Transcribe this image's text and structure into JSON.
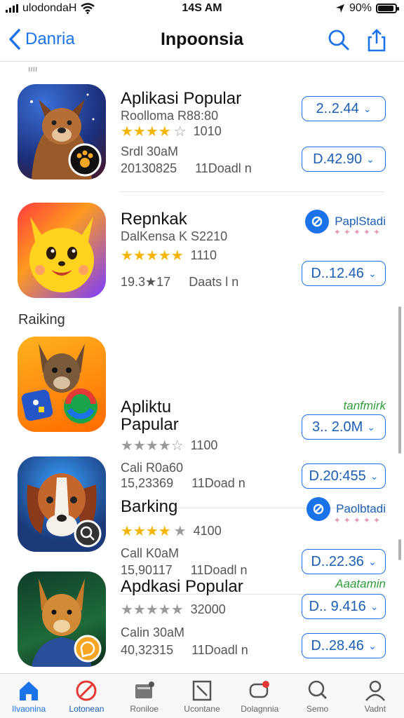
{
  "status_bar": {
    "carrier": "ulodondaH",
    "time": "14S AM",
    "battery": "90%"
  },
  "nav": {
    "back_label": "Danria",
    "title": "Inpoonsia",
    "search_icon": "search-icon",
    "share_icon": "share-icon"
  },
  "section_label": "Raiking",
  "items": [
    {
      "name": "Aplikasi Popular",
      "subtitle": "Roolloma R88:80",
      "rating": 4.5,
      "rating_count": "1010",
      "meta1": "Srdl 30aM",
      "meta2": "20130825",
      "meta3": "11Doadl n",
      "price1": "2..2.44",
      "price2": "D.42.90"
    },
    {
      "name": "Repnkak",
      "subtitle": "DalKensa K S2210",
      "rating": 5,
      "rating_count": "1110",
      "meta1": "19.3★17",
      "meta2": "Daats l n",
      "badge": "PaplStadi",
      "price1": "D..12.46"
    },
    {
      "name_line1": "Apliktu",
      "name_line2": "Papular",
      "green_label": "tanfmirk",
      "rating": 4.5,
      "rating_count": "1100",
      "meta1": "Cali R0a60",
      "meta2": "15,23369",
      "meta3": "11Doad n",
      "price1": "3.. 2.0M",
      "price2": "D.20:455"
    },
    {
      "name": "Barking",
      "badge": "Paolbtadi",
      "rating": 4.5,
      "rating_count": "4100",
      "meta1": "Call K0aM",
      "meta2": "15,90117",
      "meta3": "11Doadl n",
      "price1": "D..22.36"
    },
    {
      "name": "Apdkasi Popular",
      "green_label": "Aaatamin",
      "rating": 4.5,
      "rating_count": "32000",
      "meta1": "Calin 30aM",
      "meta2": "40,32315",
      "meta3": "11Doadl n",
      "price1": "D.. 9.416",
      "price2": "D..28.46"
    }
  ],
  "tabs": [
    {
      "label": "Ilvaonina",
      "icon": "home-icon",
      "active": true
    },
    {
      "label": "Lotonean",
      "icon": "no-entry-icon",
      "active": false
    },
    {
      "label": "Roniloe",
      "icon": "inbox-icon",
      "active": false
    },
    {
      "label": "Ucontane",
      "icon": "frame-icon",
      "active": false
    },
    {
      "label": "Dolagnnia",
      "icon": "chat-icon",
      "active": false
    },
    {
      "label": "Semo",
      "icon": "search-icon",
      "active": false
    },
    {
      "label": "Vadnt",
      "icon": "person-icon",
      "active": false
    }
  ],
  "colors": {
    "accent": "#1a73e8",
    "star": "#f4b400",
    "green": "#2e9d3a"
  }
}
